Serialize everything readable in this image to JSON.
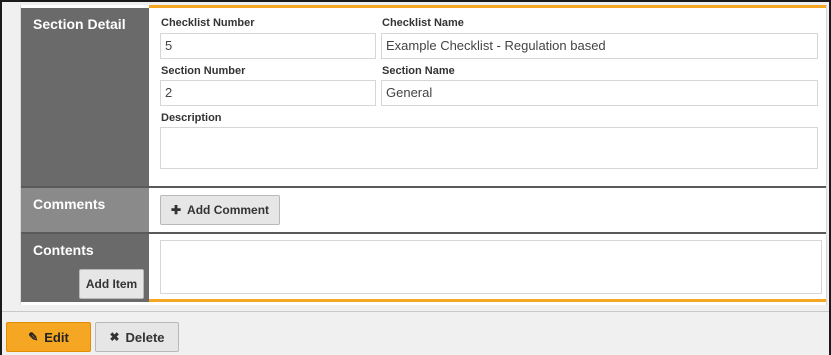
{
  "section_detail": {
    "label": "Section Detail",
    "checklist_number_label": "Checklist Number",
    "checklist_number_value": "5",
    "checklist_name_label": "Checklist Name",
    "checklist_name_value": "Example Checklist - Regulation based",
    "section_number_label": "Section Number",
    "section_number_value": "2",
    "section_name_label": "Section Name",
    "section_name_value": "General",
    "description_label": "Description",
    "description_value": ""
  },
  "comments": {
    "label": "Comments",
    "add_comment_label": "Add Comment",
    "add_comment_icon": "plus-icon"
  },
  "contents": {
    "label": "Contents",
    "add_item_label": "Add Item"
  },
  "footer": {
    "edit_label": "Edit",
    "edit_icon": "edit-icon",
    "delete_label": "Delete",
    "delete_icon": "x-icon"
  },
  "colors": {
    "accent": "#f5a623",
    "label_dark": "#6a6a6a",
    "label_mid": "#8a8a8a"
  }
}
